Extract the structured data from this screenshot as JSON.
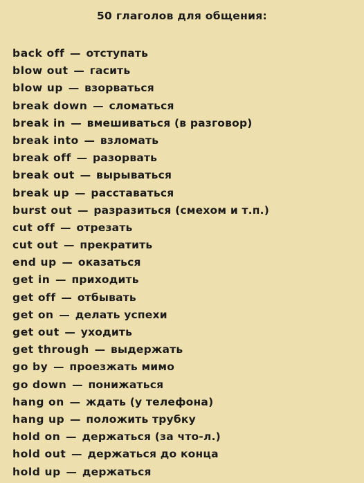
{
  "page": {
    "background_color": "#eee0ae",
    "text_color": "#1a1a1a",
    "title": "50 глаголов для общения:"
  },
  "list": {
    "separator": "—",
    "items": [
      {
        "english": "back off",
        "russian": "отступать"
      },
      {
        "english": "blow out",
        "russian": "гасить"
      },
      {
        "english": "blow up",
        "russian": "взорваться"
      },
      {
        "english": "break down",
        "russian": "сломаться"
      },
      {
        "english": "break in",
        "russian": "вмешиваться (в разговор)"
      },
      {
        "english": "break into",
        "russian": "взломать"
      },
      {
        "english": "break off",
        "russian": "разорвать"
      },
      {
        "english": "break out",
        "russian": "вырываться"
      },
      {
        "english": "break up",
        "russian": "расставаться"
      },
      {
        "english": "burst out",
        "russian": "разразиться (смехом и т.п.)"
      },
      {
        "english": "cut off",
        "russian": "отрезать"
      },
      {
        "english": "cut out",
        "russian": "прекратить"
      },
      {
        "english": "end up",
        "russian": "оказаться"
      },
      {
        "english": "get in",
        "russian": "приходить"
      },
      {
        "english": "get off",
        "russian": "отбывать"
      },
      {
        "english": "get on",
        "russian": "делать успехи"
      },
      {
        "english": "get out",
        "russian": "уходить"
      },
      {
        "english": "get through",
        "russian": "выдержать"
      },
      {
        "english": "go by",
        "russian": "проезжать мимо"
      },
      {
        "english": "go down",
        "russian": "понижаться"
      },
      {
        "english": "hang on",
        "russian": "ждать (у телефона)"
      },
      {
        "english": "hang up",
        "russian": "положить трубку"
      },
      {
        "english": "hold on",
        "russian": "держаться (за что-л.)"
      },
      {
        "english": "hold out",
        "russian": "держаться до конца"
      },
      {
        "english": "hold up",
        "russian": "держаться"
      }
    ]
  }
}
